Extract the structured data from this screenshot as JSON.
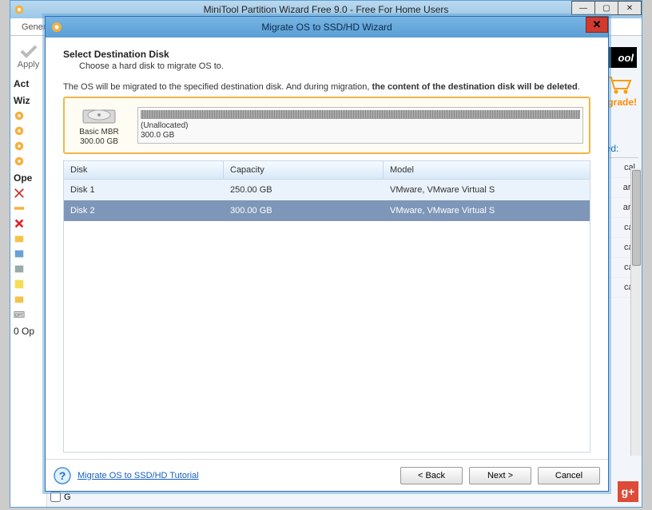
{
  "app": {
    "title": "MiniTool Partition Wizard Free 9.0 - Free For Home Users",
    "toolbar": {
      "general": "Gener"
    },
    "apply_label": "Apply",
    "sections": {
      "actions": "Act",
      "wizards": "Wiz",
      "operations": "Ope",
      "pending": "0 Op"
    },
    "bootable_checkbox": "G",
    "promo": {
      "logo": "ool",
      "upgrade": "grade!"
    },
    "right_header": "Used:",
    "right_rows": [
      "cal",
      "ary",
      "ary",
      "cal",
      "cal",
      "cal",
      "cal"
    ]
  },
  "dialog": {
    "title": "Migrate OS to SSD/HD Wizard",
    "step_title": "Select Destination Disk",
    "step_sub": "Choose a hard disk to migrate OS to.",
    "warn_pre": "The OS will be migrated to the specified destination disk. And during migration, ",
    "warn_bold": "the content of the destination disk will be deleted",
    "warn_post": ".",
    "disk_summary": {
      "type_line1": "Basic MBR",
      "type_line2": "300.00 GB",
      "unalloc_label": "(Unallocated)",
      "unalloc_size": "300.0 GB"
    },
    "table": {
      "cols": {
        "disk": "Disk",
        "capacity": "Capacity",
        "model": "Model"
      },
      "rows": [
        {
          "disk": "Disk 1",
          "capacity": "250.00 GB",
          "model": "VMware, VMware Virtual S",
          "selected": false
        },
        {
          "disk": "Disk 2",
          "capacity": "300.00 GB",
          "model": "VMware, VMware Virtual S",
          "selected": true
        }
      ]
    },
    "tutorial_link": "Migrate OS to SSD/HD Tutorial",
    "buttons": {
      "back": "< Back",
      "next": "Next >",
      "cancel": "Cancel"
    }
  }
}
